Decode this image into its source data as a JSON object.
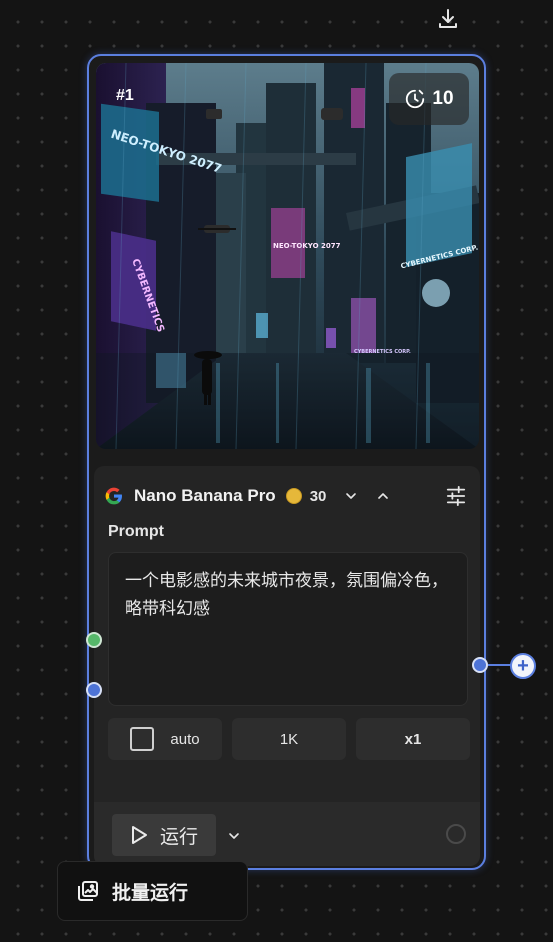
{
  "toolbar": {
    "download_icon": "download-icon"
  },
  "node": {
    "index_label": "#1",
    "count_value": "10",
    "count_icon": "timer-icon",
    "image_signs": {
      "neo_tokyo_left": "NEO-TOKYO\n2077",
      "cybernetics_left": "CYBERNETICS",
      "neo_tokyo_center": "NEO-TOKYO\n2077",
      "cybernetics_corp": "CYBERNETICS CORP.",
      "cybernetics_corp_small": "CYBERNETICS CORP."
    },
    "model": {
      "logo_icon": "google-g-icon",
      "name": "Nano Banana Pro",
      "cost": "30",
      "cost_icon": "coin-icon"
    },
    "prompt": {
      "label": "Prompt",
      "value": "一个电影感的未来城市夜景，氛围偏冷色，略带科幻感"
    },
    "options": {
      "auto_label": "auto",
      "resolution": "1K",
      "multiplier": "x1"
    },
    "run": {
      "label": "运行",
      "icon": "play-icon"
    }
  },
  "batch": {
    "label": "批量运行",
    "icon": "batch-images-icon"
  },
  "colors": {
    "accent": "#5b7fe0",
    "port_green": "#56b86a",
    "coin": "#e6b83a"
  }
}
